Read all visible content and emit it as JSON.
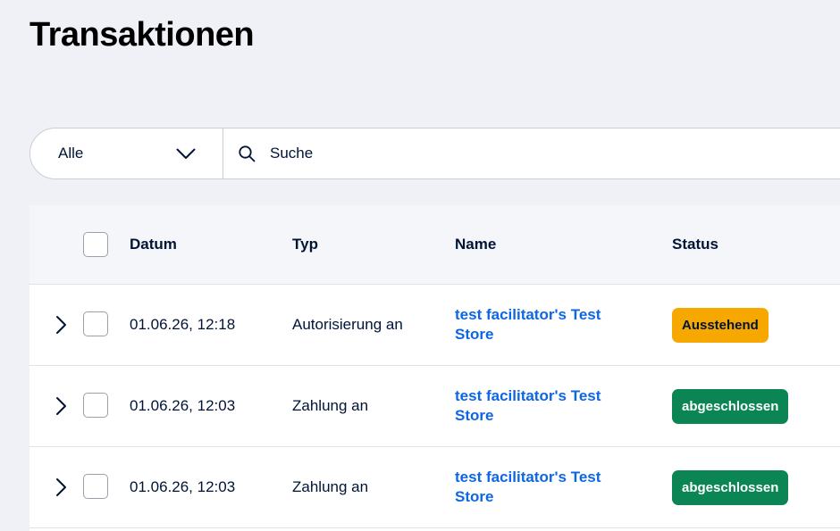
{
  "page": {
    "title": "Transaktionen"
  },
  "filter": {
    "type_selected": "Alle",
    "search_placeholder": "Suche"
  },
  "table": {
    "columns": {
      "date": "Datum",
      "type": "Typ",
      "name": "Name",
      "status": "Status"
    },
    "rows": [
      {
        "date": "01.06.26, 12:18",
        "type": "Autorisierung an",
        "name": "test facilitator's Test Store",
        "status": "Ausstehend",
        "status_kind": "pending"
      },
      {
        "date": "01.06.26, 12:03",
        "type": "Zahlung an",
        "name": "test facilitator's Test Store",
        "status": "abgeschlossen",
        "status_kind": "done"
      },
      {
        "date": "01.06.26, 12:03",
        "type": "Zahlung an",
        "name": "test facilitator's Test Store",
        "status": "abgeschlossen",
        "status_kind": "done"
      }
    ]
  },
  "colors": {
    "background": "#eff1f7",
    "link": "#0d66e4",
    "status_pending": "#f7a800",
    "status_done": "#0a8553"
  },
  "icons": {
    "dropdown": "chevron-down-icon",
    "search": "search-icon",
    "expand": "chevron-right-icon"
  }
}
